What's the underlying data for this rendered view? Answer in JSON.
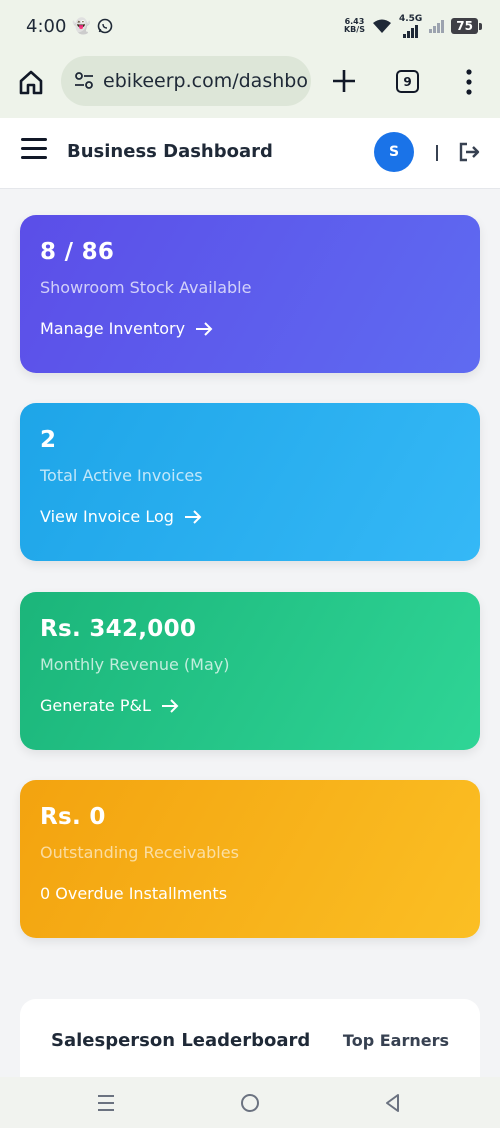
{
  "status_bar": {
    "time": "4:00",
    "net_speed_value": "6.43",
    "net_speed_unit": "KB/S",
    "signal_label": "4.5G",
    "battery": "75"
  },
  "browser": {
    "url": "ebikeerp.com/dashbo",
    "tab_count": "9"
  },
  "header": {
    "title": "Business Dashboard",
    "avatar_initial": "S",
    "divider": "|"
  },
  "cards": [
    {
      "value": "8 / 86",
      "subtitle": "Showroom Stock Available",
      "action": "Manage Inventory",
      "color": "#5b4ee8"
    },
    {
      "value": "2",
      "subtitle": "Total Active Invoices",
      "action": "View Invoice Log",
      "color": "#1ea5e8"
    },
    {
      "value": "Rs. 342,000",
      "subtitle": "Monthly Revenue (May)",
      "action": "Generate P&L",
      "color": "#1bb57a"
    },
    {
      "value": "Rs. 0",
      "subtitle": "Outstanding Receivables",
      "action": "0 Overdue Installments",
      "color": "#f3a30f"
    }
  ],
  "leaderboard": {
    "title": "Salesperson Leaderboard",
    "tab": "Top Earners"
  }
}
